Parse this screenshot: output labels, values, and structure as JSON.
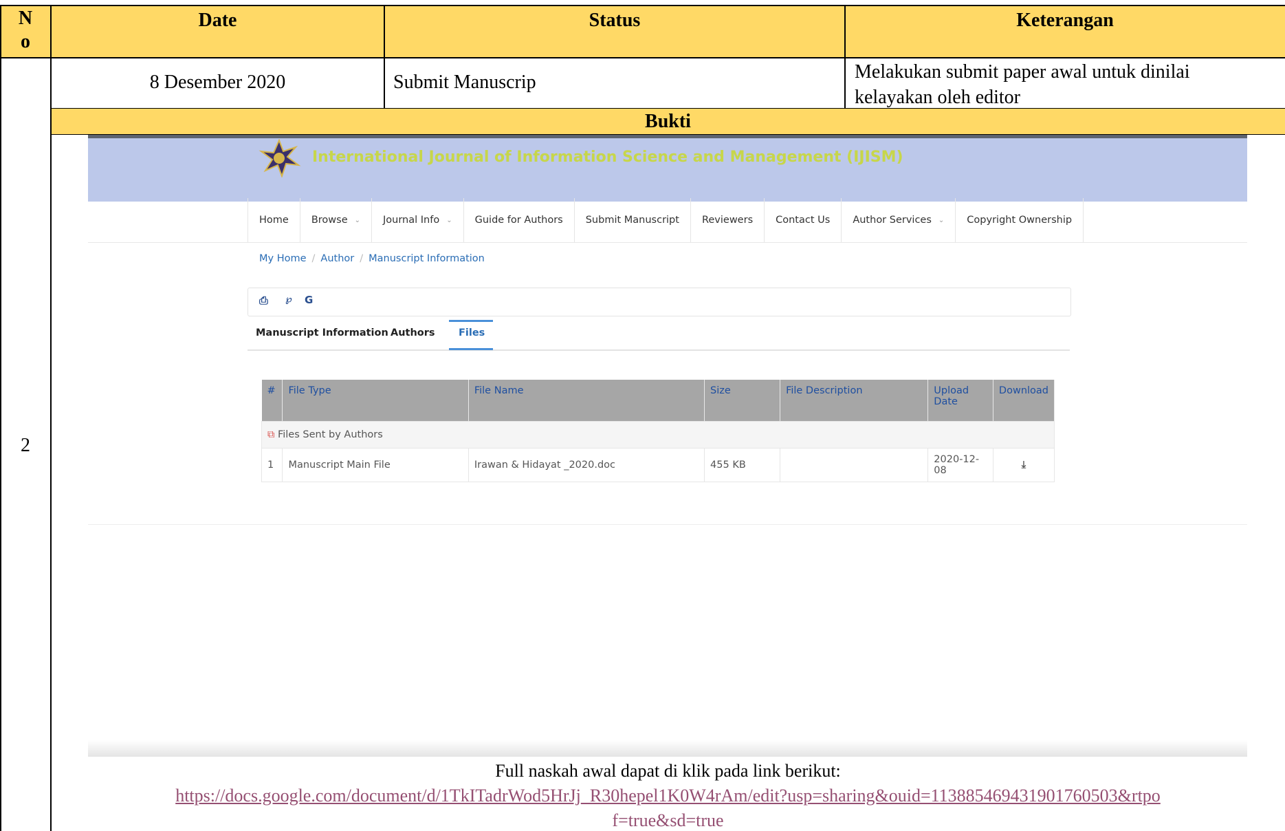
{
  "table": {
    "headers": {
      "no": "N o",
      "date": "Date",
      "status": "Status",
      "keterangan": "Keterangan"
    },
    "row": {
      "no": "2",
      "date": "8 Desember 2020",
      "status": "Submit Manuscrip",
      "keterangan": "Melakukan submit paper awal untuk dinilai kelayakan oleh editor"
    },
    "bukti_label": "Bukti",
    "header_color": "#ffd966"
  },
  "screenshot": {
    "journal_title": "International Journal of Information Science and Management (IJISM)",
    "nav": [
      {
        "label": "Home",
        "dropdown": false
      },
      {
        "label": "Browse",
        "dropdown": true
      },
      {
        "label": "Journal Info",
        "dropdown": true
      },
      {
        "label": "Guide for Authors",
        "dropdown": false
      },
      {
        "label": "Submit Manuscript",
        "dropdown": false
      },
      {
        "label": "Reviewers",
        "dropdown": false
      },
      {
        "label": "Contact Us",
        "dropdown": false
      },
      {
        "label": "Author Services",
        "dropdown": true
      },
      {
        "label": "Copyright Ownership",
        "dropdown": false
      }
    ],
    "breadcrumb": [
      "My Home",
      "Author",
      "Manuscript Information"
    ],
    "toolbar_icons": [
      "print-icon",
      "scholar-icon",
      "google-icon"
    ],
    "tabs": [
      {
        "label": "Manuscript Information",
        "active": false
      },
      {
        "label": "Authors",
        "active": false
      },
      {
        "label": "Files",
        "active": true
      }
    ],
    "files_table": {
      "headers": [
        "#",
        "File Type",
        "File Name",
        "Size",
        "File Description",
        "Upload Date",
        "Download"
      ],
      "group_label": "Files Sent by Authors",
      "rows": [
        {
          "num": "1",
          "type": "Manuscript Main File",
          "name": "Irawan & Hidayat _2020.doc",
          "size": "455 KB",
          "description": "",
          "date": "2020-12-08"
        }
      ]
    }
  },
  "footer": {
    "intro": "Full naskah awal dapat di klik pada link berikut:",
    "link_line1": "https://docs.google.com/document/d/1TkITadrWod5HrJj_R30hepel1K0W4rAm/edit?usp=sharing&ouid=113885469431901760503&rtpo",
    "link_line2": "f=true&sd=true"
  }
}
